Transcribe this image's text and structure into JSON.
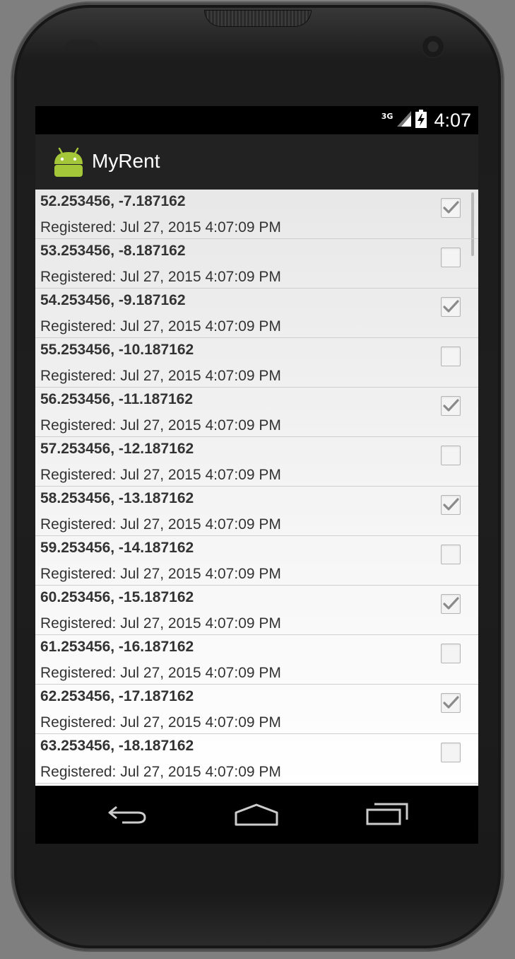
{
  "status_bar": {
    "network": "3G",
    "time": "4:07"
  },
  "app": {
    "title": "MyRent",
    "icon": "android-robot-icon",
    "accent": "#a4c639"
  },
  "residences": [
    {
      "coords": "52.253456, -7.187162",
      "date": "Registered: Jul 27, 2015 4:07:09 PM",
      "checked": true
    },
    {
      "coords": "53.253456, -8.187162",
      "date": "Registered: Jul 27, 2015 4:07:09 PM",
      "checked": false
    },
    {
      "coords": "54.253456, -9.187162",
      "date": "Registered: Jul 27, 2015 4:07:09 PM",
      "checked": true
    },
    {
      "coords": "55.253456, -10.187162",
      "date": "Registered: Jul 27, 2015 4:07:09 PM",
      "checked": false
    },
    {
      "coords": "56.253456, -11.187162",
      "date": "Registered: Jul 27, 2015 4:07:09 PM",
      "checked": true
    },
    {
      "coords": "57.253456, -12.187162",
      "date": "Registered: Jul 27, 2015 4:07:09 PM",
      "checked": false
    },
    {
      "coords": "58.253456, -13.187162",
      "date": "Registered: Jul 27, 2015 4:07:09 PM",
      "checked": true
    },
    {
      "coords": "59.253456, -14.187162",
      "date": "Registered: Jul 27, 2015 4:07:09 PM",
      "checked": false
    },
    {
      "coords": "60.253456, -15.187162",
      "date": "Registered: Jul 27, 2015 4:07:09 PM",
      "checked": true
    },
    {
      "coords": "61.253456, -16.187162",
      "date": "Registered: Jul 27, 2015 4:07:09 PM",
      "checked": false
    },
    {
      "coords": "62.253456, -17.187162",
      "date": "Registered: Jul 27, 2015 4:07:09 PM",
      "checked": true
    },
    {
      "coords": "63.253456, -18.187162",
      "date": "Registered: Jul 27, 2015 4:07:09 PM",
      "checked": false
    }
  ],
  "nav": {
    "back_icon": "back-arrow-icon",
    "home_icon": "home-icon",
    "recents_icon": "recent-apps-icon"
  }
}
